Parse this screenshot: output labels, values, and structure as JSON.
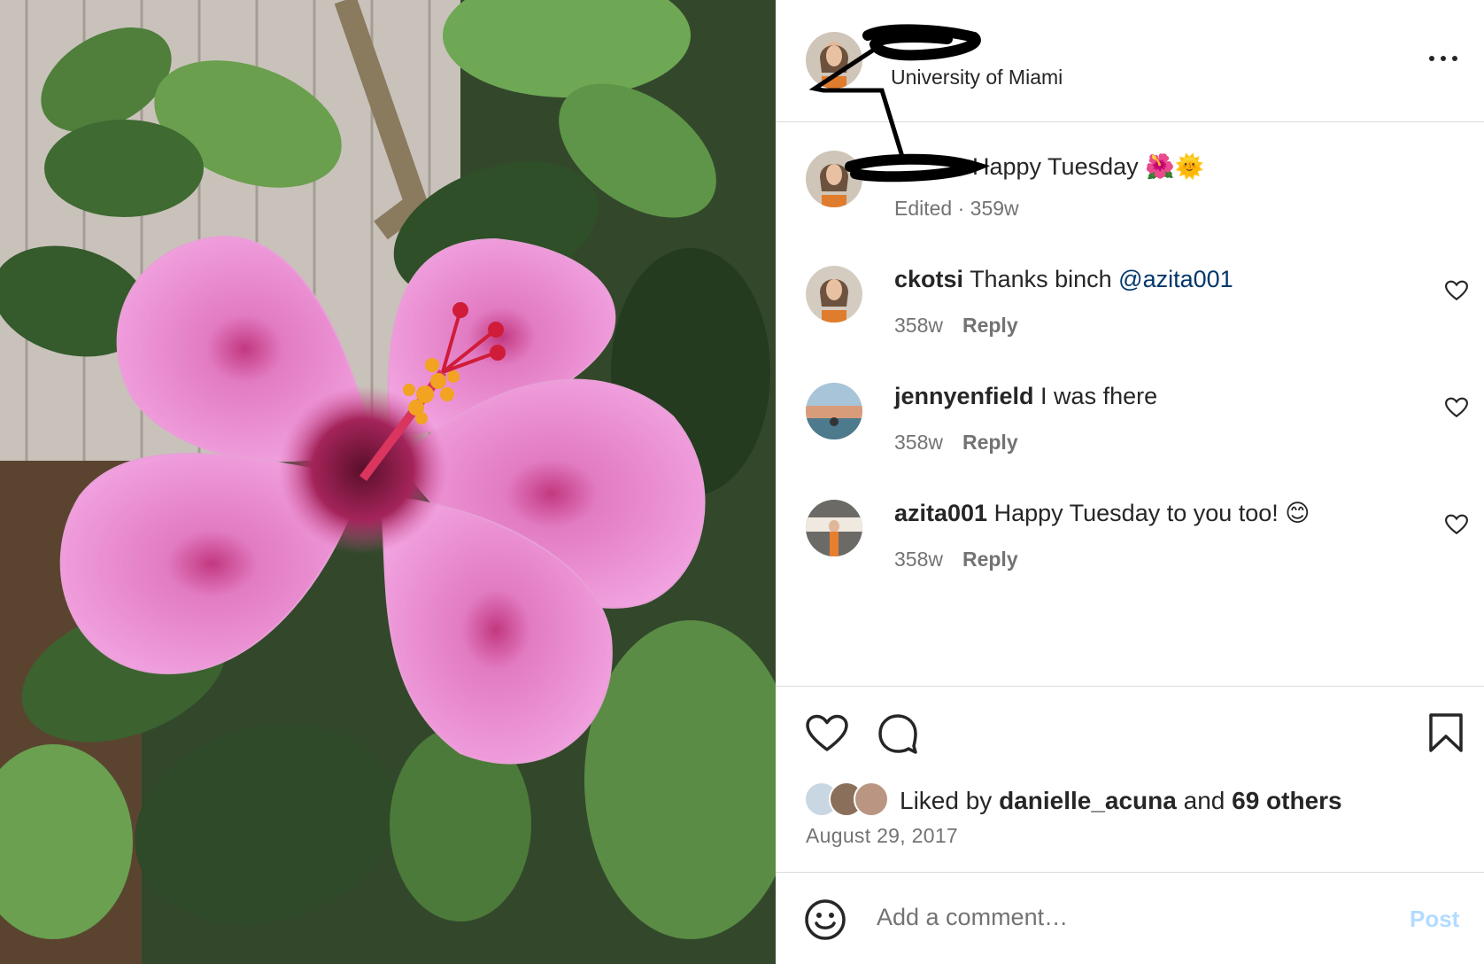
{
  "post": {
    "location": "University of Miami",
    "caption_text": "Happy Tuesday 🌺🌞",
    "caption_meta": "Edited · 359w"
  },
  "comments": [
    {
      "user": "ckotsi",
      "text": "Thanks binch ",
      "mention": "@azita001",
      "age": "358w",
      "reply_label": "Reply"
    },
    {
      "user": "jennyenfield",
      "text": "I was fhere",
      "age": "358w",
      "reply_label": "Reply"
    },
    {
      "user": "azita001",
      "text": "Happy Tuesday to you too! 😊",
      "age": "358w",
      "reply_label": "Reply"
    }
  ],
  "likes": {
    "prefix": "Liked by ",
    "user": "danielle_acuna",
    "connector": " and ",
    "others": "69 others"
  },
  "date": "August 29, 2017",
  "composer": {
    "placeholder": "Add a comment…",
    "post_label": "Post"
  },
  "icons": {
    "more": "more-horizontal-icon",
    "like": "heart-icon",
    "comment": "comment-bubble-icon",
    "save": "bookmark-icon",
    "emoji": "emoji-smiley-icon"
  },
  "colors": {
    "text": "#262626",
    "secondary": "#737373",
    "mention": "#00376b",
    "post_disabled": "#b3dbff",
    "divider": "#dbdbdb"
  }
}
